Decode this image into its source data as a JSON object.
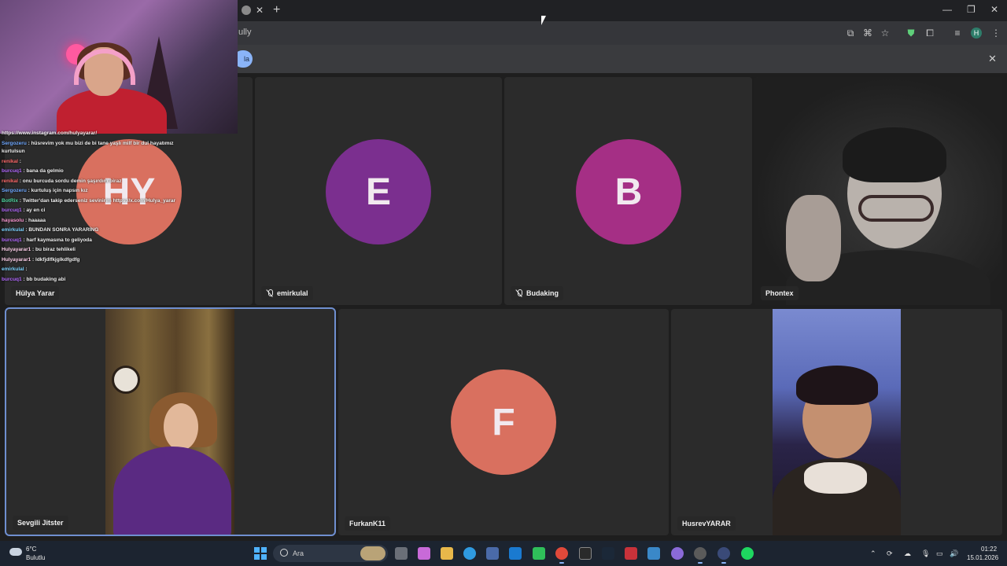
{
  "browser": {
    "url": "ully",
    "info_pill": "la",
    "profile_initial": "H"
  },
  "meeting": {
    "participants": [
      {
        "name": "Hülya Yarar",
        "initials": "HY",
        "color": "#d9705f"
      },
      {
        "name": "emirkulal",
        "initials": "E",
        "color": "#7b2f8f",
        "muted": true
      },
      {
        "name": "Budaking",
        "initials": "B",
        "color": "#a52f85",
        "muted": true
      },
      {
        "name": "Phontex",
        "video": true
      },
      {
        "name": "Sevgili Jitster",
        "video": true
      },
      {
        "name": "FurkanK11",
        "initials": "F",
        "color": "#d9705f"
      },
      {
        "name": "HusrevYARAR",
        "video": true
      }
    ]
  },
  "chat": {
    "top_line": "https://www.instagram.com/hulyayarar/",
    "messages": [
      {
        "user": "Sergozeru",
        "text": ": hüsrevim yok mu bizi de bi tane yaşlı milf bir dul hayatımız",
        "user_color": "#6fa8ff"
      },
      {
        "user": "",
        "text": "kurtulsun",
        "user_color": "#f0f0f0"
      },
      {
        "user": "renikal",
        "text": ":",
        "user_color": "#ff6a6a"
      },
      {
        "user": "burcuq1",
        "text": ": bana da gelmio",
        "user_color": "#b36aff"
      },
      {
        "user": "renikal",
        "text": ": onu burcuda sordu demin şaşırdım biraz",
        "user_color": "#ff6a6a"
      },
      {
        "user": "Sergozeru",
        "text": ": kurtuluş için napsın kız",
        "user_color": "#6fa8ff"
      },
      {
        "user": "BotRix",
        "text": ": Twitter'dan takip ederseniz sevinirim https://x.com/Hulya_yarar",
        "user_color": "#4fd6a0"
      },
      {
        "user": "burcuq1",
        "text": ": ay en ci",
        "user_color": "#b36aff"
      },
      {
        "user": "hayasolu",
        "text": ": haaaaa",
        "user_color": "#ff9ad5"
      },
      {
        "user": "emirkulal",
        "text": ": BUNDAN SONRA YARARİNG",
        "user_color": "#7dd3ff"
      },
      {
        "user": "burcuq1",
        "text": ": harf kaymasına to geliyoda",
        "user_color": "#b36aff"
      },
      {
        "user": "Hulyayarar1",
        "text": ": bu biraz tehlikeli",
        "user_color": "#ffd1ec"
      },
      {
        "user": "Hulyayarar1",
        "text": ": ldkfjdlfkjglkdfgdfg",
        "user_color": "#ffd1ec"
      },
      {
        "user": "emirkulal",
        "text": ":",
        "user_color": "#7dd3ff"
      },
      {
        "user": "burcuq1",
        "text": ": bb budaking abi",
        "user_color": "#b36aff"
      }
    ]
  },
  "taskbar": {
    "weather_temp": "6°C",
    "weather_desc": "Bulutlu",
    "search_placeholder": "Ara",
    "time": "01:22",
    "date": "15.01.2026"
  }
}
